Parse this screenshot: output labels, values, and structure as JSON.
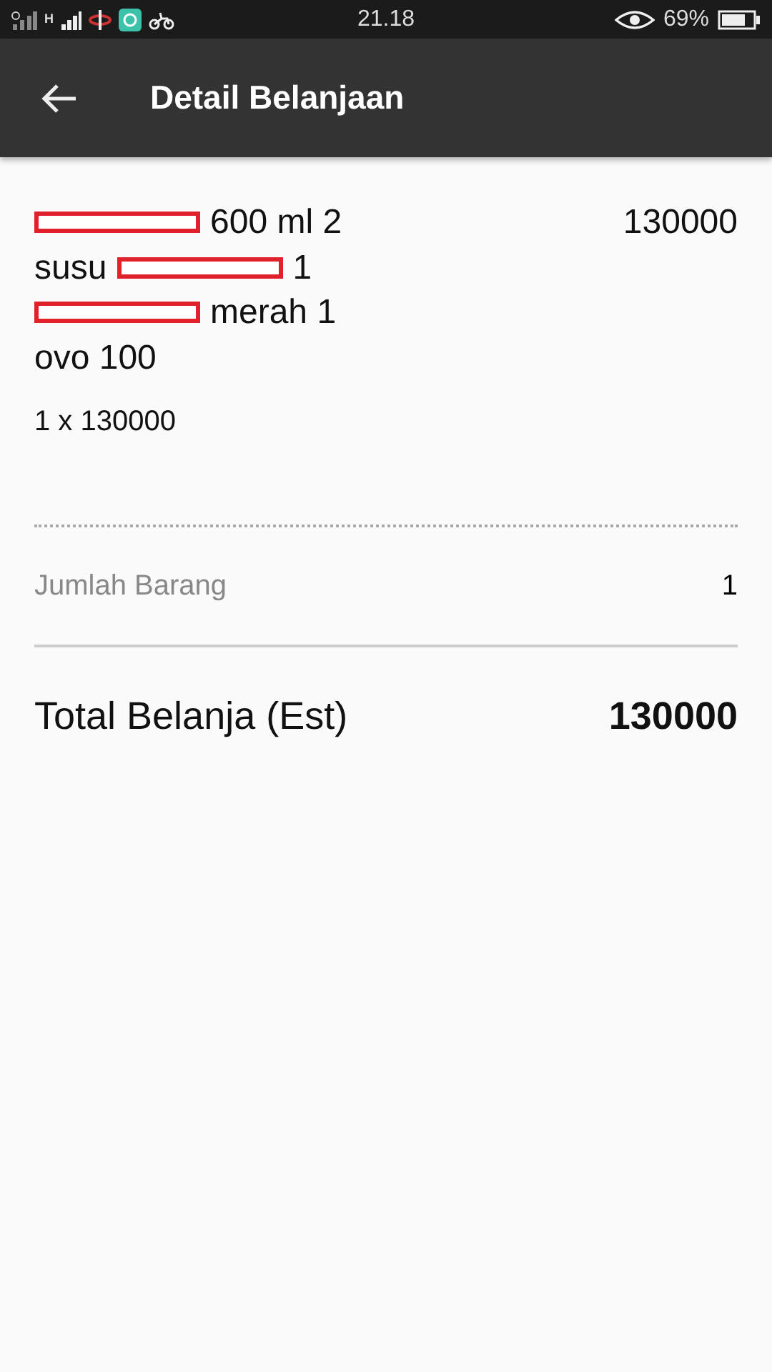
{
  "status_bar": {
    "time": "21.18",
    "network_label": "H",
    "battery": "69%"
  },
  "app_bar": {
    "title": "Detail Belanjaan"
  },
  "item": {
    "lines": [
      [
        {
          "kind": "redaction"
        },
        {
          "kind": "text",
          "text": "600 ml 2"
        }
      ],
      [
        {
          "kind": "text",
          "text": "susu"
        },
        {
          "kind": "redaction"
        },
        {
          "kind": "text",
          "text": "1"
        }
      ],
      [
        {
          "kind": "redaction"
        },
        {
          "kind": "text",
          "text": "merah 1"
        }
      ],
      [
        {
          "kind": "text",
          "text": "ovo 100"
        }
      ]
    ],
    "price": "130000",
    "quantity_line": "1 x  130000"
  },
  "summary": {
    "count_label": "Jumlah Barang",
    "count_value": "1",
    "total_label": "Total Belanja (Est)",
    "total_value": "130000"
  }
}
